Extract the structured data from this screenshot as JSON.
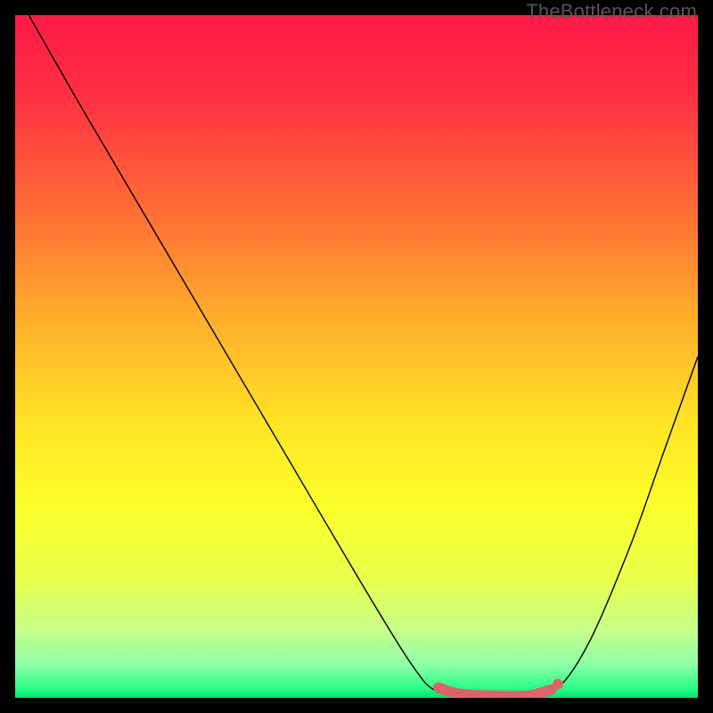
{
  "watermark": "TheBottleneck.com",
  "chart_data": {
    "type": "line",
    "title": "",
    "xlabel": "",
    "ylabel": "",
    "xlim": [
      0,
      100
    ],
    "ylim": [
      0,
      100
    ],
    "gradient_stops": [
      {
        "offset": 0.0,
        "color": "#ff1a47"
      },
      {
        "offset": 0.12,
        "color": "#ff3042"
      },
      {
        "offset": 0.28,
        "color": "#ff6a36"
      },
      {
        "offset": 0.45,
        "color": "#ffb02a"
      },
      {
        "offset": 0.6,
        "color": "#ffe424"
      },
      {
        "offset": 0.72,
        "color": "#fbff2a"
      },
      {
        "offset": 0.82,
        "color": "#eaff48"
      },
      {
        "offset": 0.9,
        "color": "#c7ff88"
      },
      {
        "offset": 0.95,
        "color": "#8effa8"
      },
      {
        "offset": 0.985,
        "color": "#2dff88"
      },
      {
        "offset": 1.0,
        "color": "#00e46c"
      }
    ],
    "series": [
      {
        "name": "bottleneck-curve",
        "stroke": "#000000",
        "stroke_width": 1.4,
        "points": [
          {
            "x": 2.0,
            "y": 100.0
          },
          {
            "x": 10.0,
            "y": 86.0
          },
          {
            "x": 20.0,
            "y": 69.0
          },
          {
            "x": 30.0,
            "y": 52.0
          },
          {
            "x": 40.0,
            "y": 35.0
          },
          {
            "x": 50.0,
            "y": 18.0
          },
          {
            "x": 58.0,
            "y": 5.0
          },
          {
            "x": 62.0,
            "y": 0.8
          },
          {
            "x": 68.0,
            "y": 0.0
          },
          {
            "x": 74.0,
            "y": 0.0
          },
          {
            "x": 79.0,
            "y": 1.0
          },
          {
            "x": 84.0,
            "y": 8.0
          },
          {
            "x": 90.0,
            "y": 22.0
          },
          {
            "x": 95.0,
            "y": 36.0
          },
          {
            "x": 100.0,
            "y": 50.0
          }
        ]
      }
    ],
    "highlight": {
      "name": "recommended-range",
      "stroke": "#d9656b",
      "stroke_width": 12,
      "points": [
        {
          "x": 62.0,
          "y": 1.5
        },
        {
          "x": 65.0,
          "y": 0.6
        },
        {
          "x": 70.0,
          "y": 0.3
        },
        {
          "x": 75.0,
          "y": 0.3
        },
        {
          "x": 78.5,
          "y": 1.2
        }
      ],
      "end_dot": {
        "x": 79.5,
        "y": 2.0,
        "r": 6
      }
    }
  }
}
